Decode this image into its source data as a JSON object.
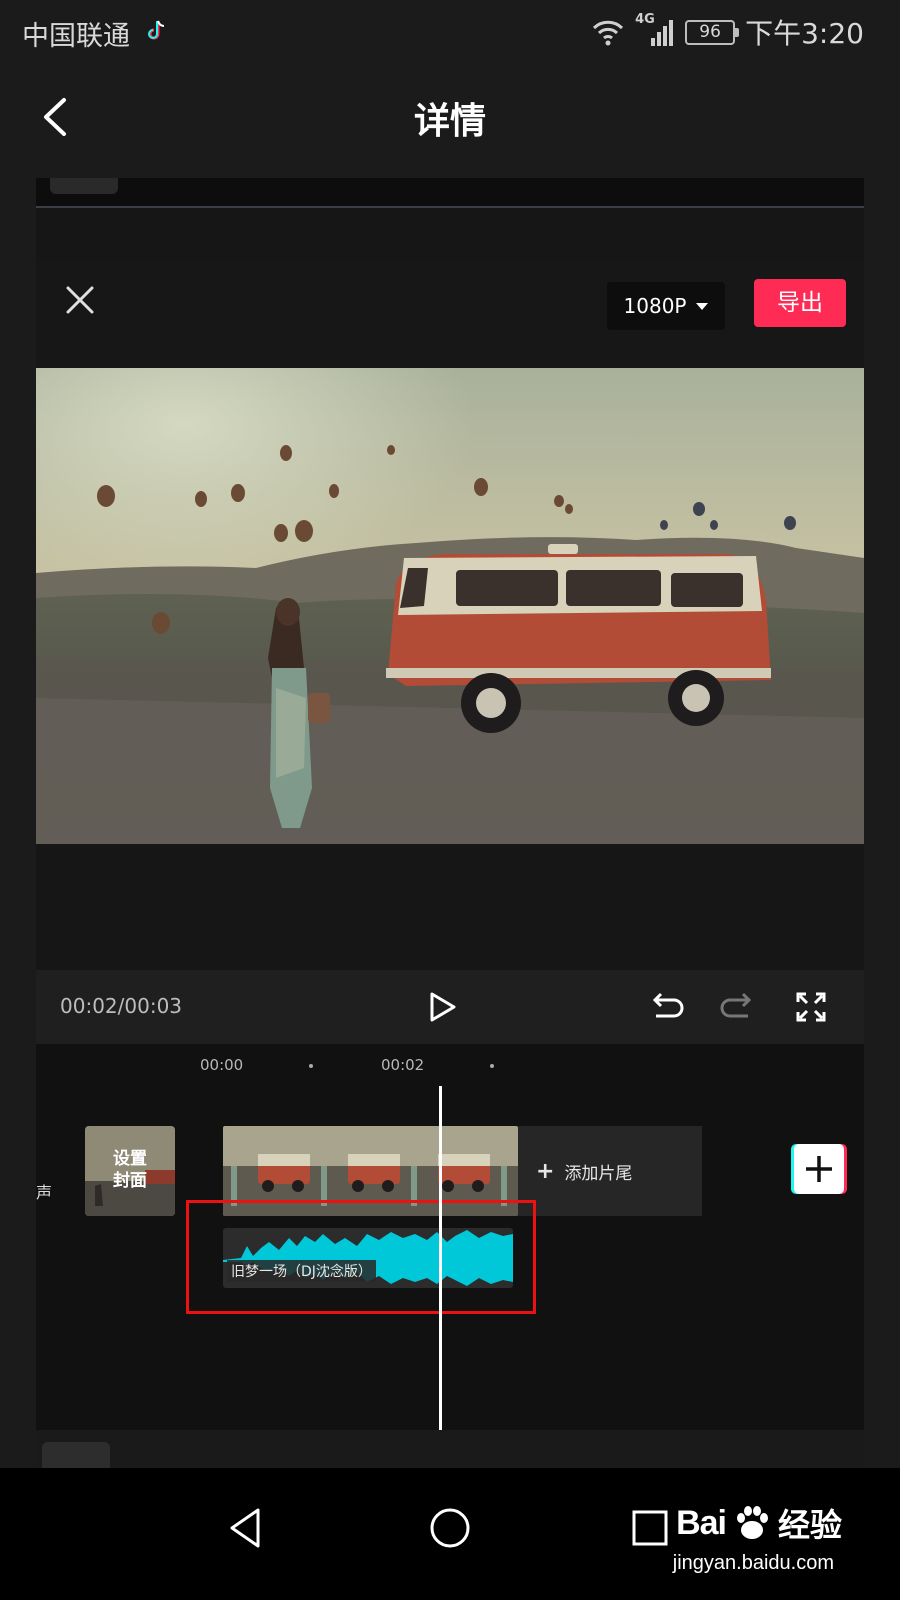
{
  "status_bar": {
    "carrier": "中国联通",
    "network": "4G",
    "battery": "96",
    "time": "下午3:20"
  },
  "header": {
    "title": "详情"
  },
  "editor": {
    "resolution": "1080P",
    "export_label": "导出",
    "timecode": "00:02/00:03"
  },
  "timeline": {
    "ruler": [
      "00:00",
      "00:02"
    ],
    "side_label": "声",
    "cover_label": "设置\n封面",
    "add_ending_label": "添加片尾",
    "audio_title": "旧梦一场（DJ沈念版）"
  },
  "watermark": {
    "brand": "Bai",
    "brand_tail": "经验",
    "url": "jingyan.baidu.com"
  },
  "colors": {
    "accent": "#fe2c55",
    "audio_wave": "#00c8d8",
    "highlight": "#e11111"
  }
}
